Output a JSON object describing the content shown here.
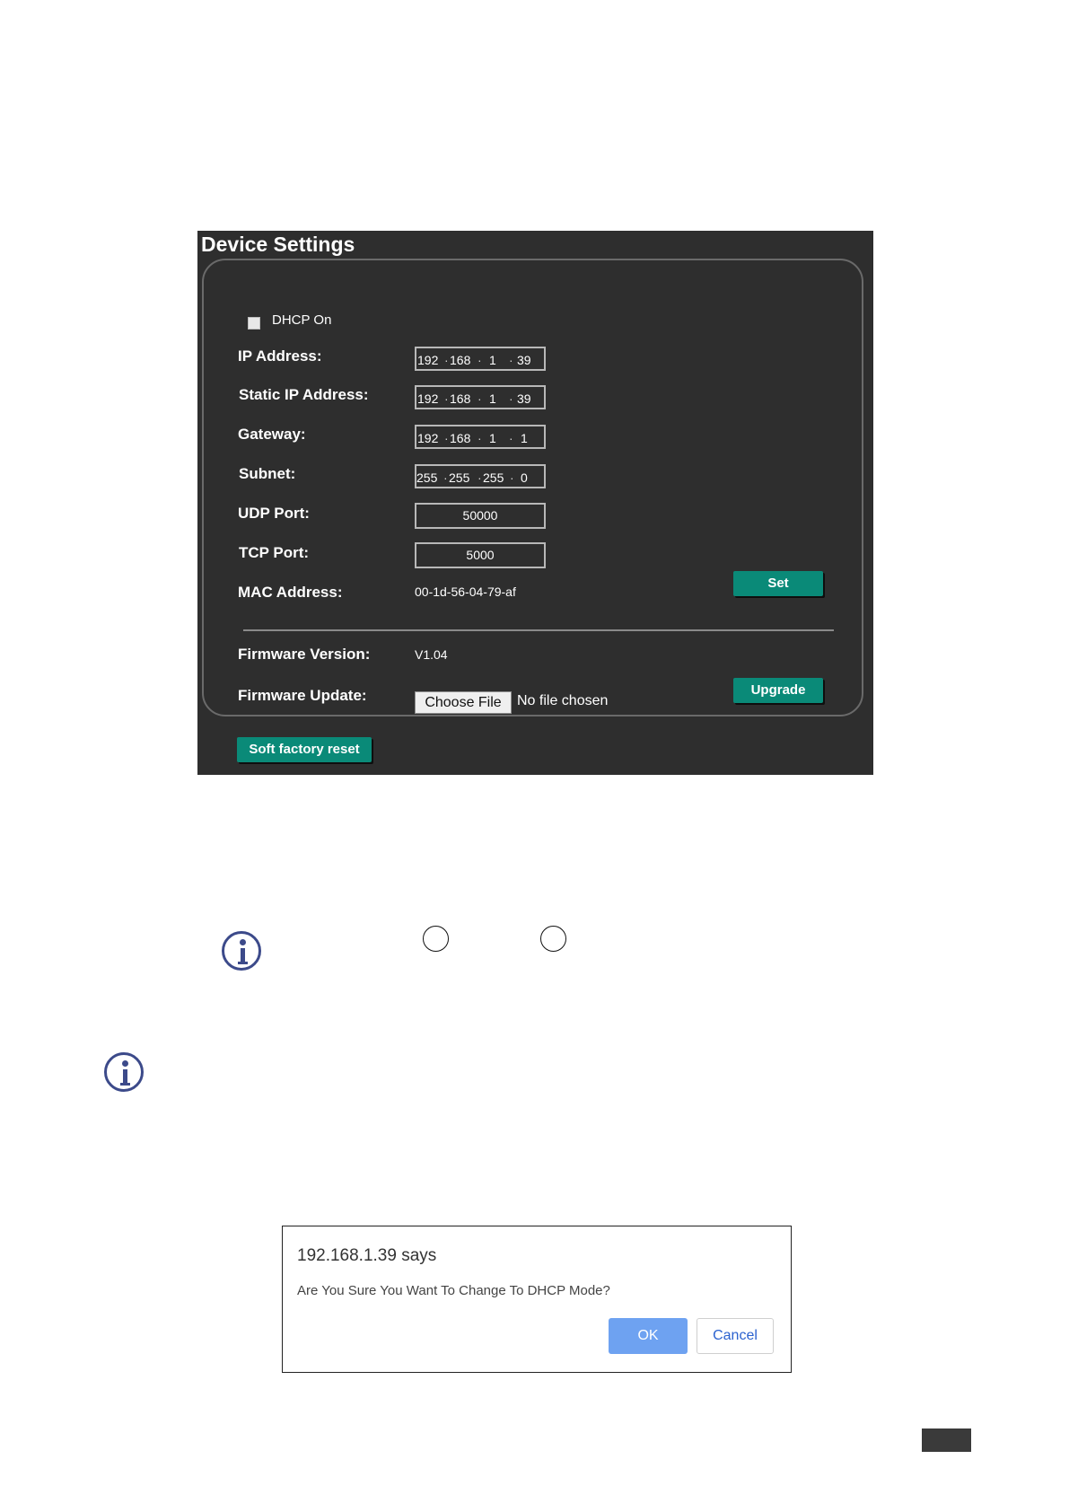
{
  "device_settings": {
    "title": "Device Settings",
    "dhcp_label": "DHCP On",
    "dhcp_checked": false,
    "fields": {
      "ip_label": "IP Address:",
      "ip": [
        "192",
        "168",
        "1",
        "39"
      ],
      "static_ip_label": "Static IP Address:",
      "static_ip": [
        "192",
        "168",
        "1",
        "39"
      ],
      "gateway_label": "Gateway:",
      "gateway": [
        "192",
        "168",
        "1",
        "1"
      ],
      "subnet_label": "Subnet:",
      "subnet": [
        "255",
        "255",
        "255",
        "0"
      ],
      "udp_label": "UDP Port:",
      "udp_value": "50000",
      "tcp_label": "TCP Port:",
      "tcp_value": "5000",
      "mac_label": "MAC Address:",
      "mac_value": "00-1d-56-04-79-af"
    },
    "set_button": "Set",
    "firmware": {
      "version_label": "Firmware Version:",
      "version_value": "V1.04",
      "update_label": "Firmware Update:",
      "choose_file": "Choose File",
      "no_file": "No file chosen",
      "upgrade_button": "Upgrade"
    },
    "soft_reset_button": "Soft factory reset",
    "colors": {
      "panel_bg": "#2e2e2e",
      "button_teal": "#0a8a78"
    }
  },
  "icons": [
    "info-icon",
    "info-icon"
  ],
  "dialog": {
    "title": "192.168.1.39 says",
    "message": "Are You Sure You Want To Change To DHCP Mode?",
    "ok": "OK",
    "cancel": "Cancel",
    "colors": {
      "ok_bg": "#6ea2f1",
      "cancel_text": "#2b62cf"
    }
  }
}
